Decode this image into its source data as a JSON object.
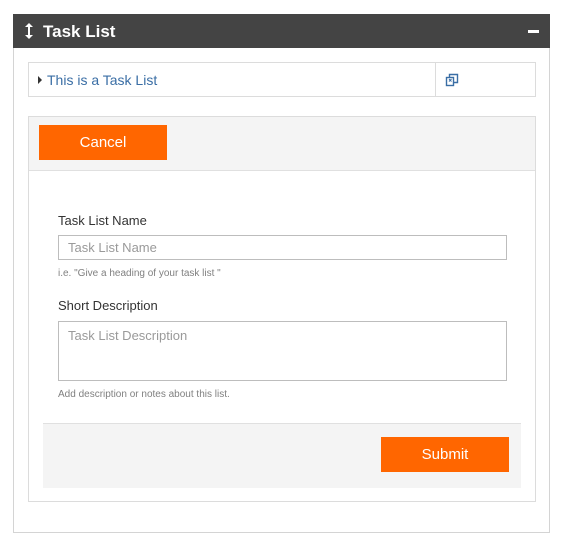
{
  "header": {
    "title": "Task List",
    "drag_icon": "vertical-resize-arrows-icon",
    "collapse_icon": "minus-icon"
  },
  "task_list": {
    "item_label": "This is a Task List",
    "expand_icon": "caret-right-icon",
    "copy_icon": "copy-icon"
  },
  "form": {
    "cancel_label": "Cancel",
    "name_label": "Task List Name",
    "name_placeholder": "Task List Name",
    "name_value": "",
    "name_help": "i.e. \"Give a heading of your task list \"",
    "description_label": "Short Description",
    "description_placeholder": "Task List Description",
    "description_value": "",
    "description_help": "Add description or notes about this list.",
    "submit_label": "Submit"
  },
  "colors": {
    "header_bg": "#444444",
    "accent": "#ff6600",
    "link": "#3a6ea5"
  }
}
